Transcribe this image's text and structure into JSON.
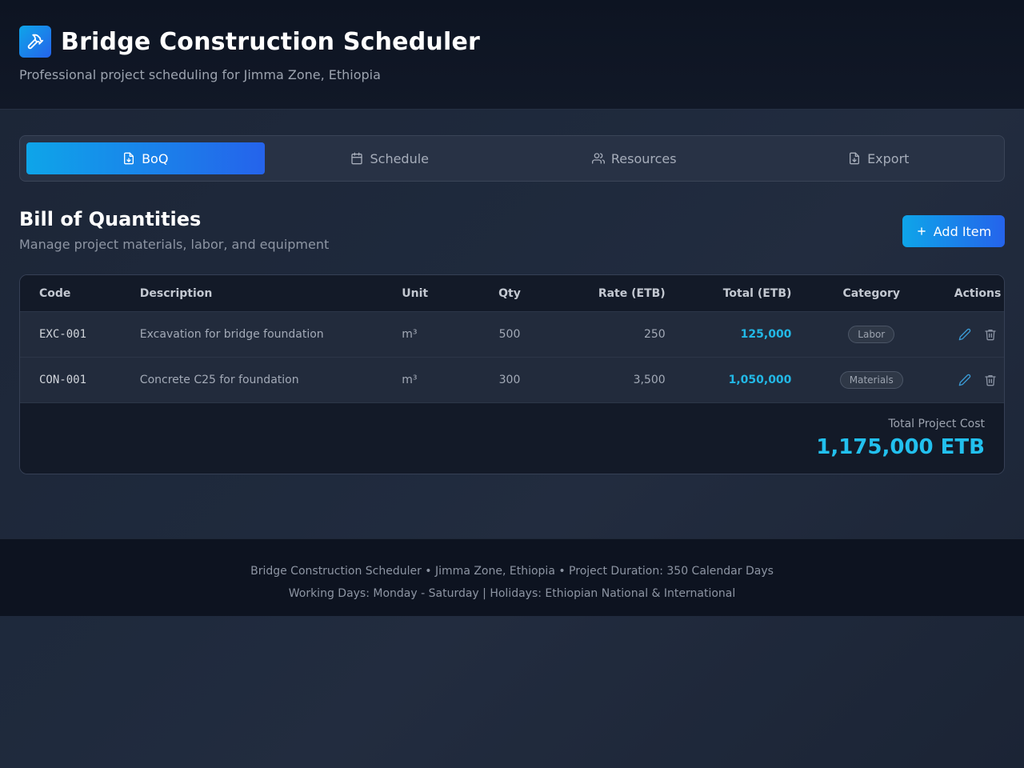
{
  "header": {
    "title": "Bridge Construction Scheduler",
    "subtitle": "Professional project scheduling for Jimma Zone, Ethiopia",
    "logo_icon": "hammer-icon"
  },
  "tabs": [
    {
      "label": "BoQ",
      "icon": "file-icon",
      "active": true
    },
    {
      "label": "Schedule",
      "icon": "calendar-icon",
      "active": false
    },
    {
      "label": "Resources",
      "icon": "users-icon",
      "active": false
    },
    {
      "label": "Export",
      "icon": "file-download-icon",
      "active": false
    }
  ],
  "section": {
    "title": "Bill of Quantities",
    "subtitle": "Manage project materials, labor, and equipment",
    "add_button": "Add Item"
  },
  "table": {
    "columns": [
      "Code",
      "Description",
      "Unit",
      "Qty",
      "Rate (ETB)",
      "Total (ETB)",
      "Category",
      "Actions"
    ],
    "rows": [
      {
        "code": "EXC-001",
        "description": "Excavation for bridge foundation",
        "unit": "m³",
        "qty": "500",
        "rate": "250",
        "total": "125,000",
        "category": "Labor"
      },
      {
        "code": "CON-001",
        "description": "Concrete C25 for foundation",
        "unit": "m³",
        "qty": "300",
        "rate": "3,500",
        "total": "1,050,000",
        "category": "Materials"
      }
    ],
    "total_label": "Total Project Cost",
    "total_value": "1,175,000 ETB"
  },
  "footer": {
    "line1": "Bridge Construction Scheduler • Jimma Zone, Ethiopia • Project Duration: 350 Calendar Days",
    "line2": "Working Days: Monday - Saturday | Holidays: Ethiopian National & International"
  },
  "colors": {
    "accent_start": "#0ea5e9",
    "accent_end": "#2563eb",
    "total_text": "#22b8e6"
  }
}
